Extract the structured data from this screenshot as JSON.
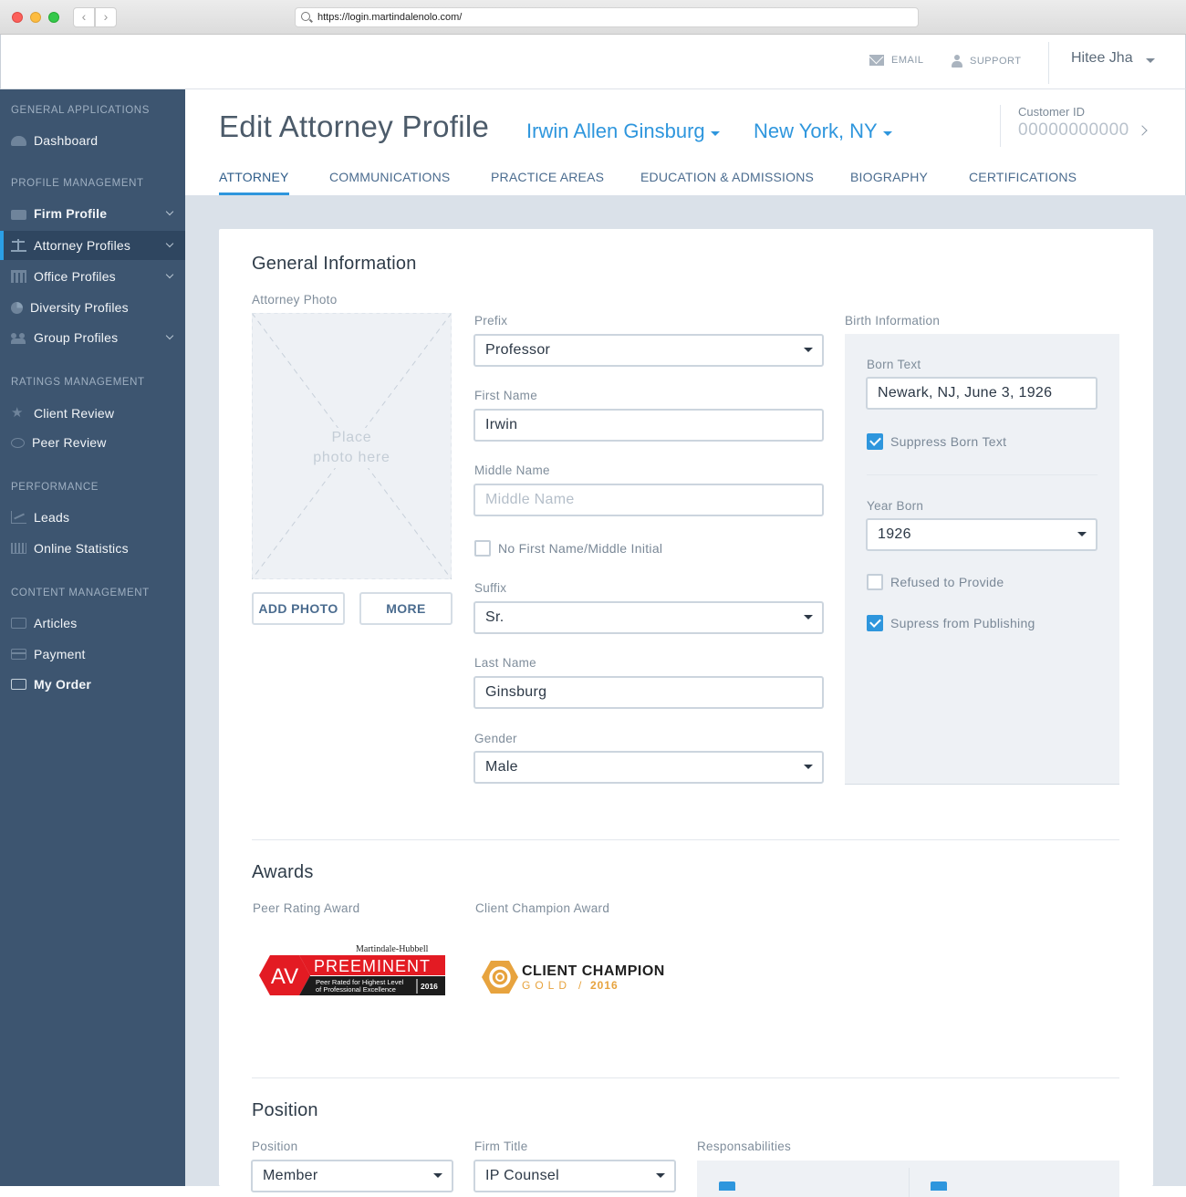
{
  "browser": {
    "url": "https://login.martindalenolo.com/"
  },
  "header": {
    "email_label": "EMAIL",
    "support_label": "SUPPORT",
    "user_name": "Hitee Jha"
  },
  "sidebar": {
    "sections": [
      {
        "title": "GENERAL APPLICATIONS"
      },
      {
        "title": "PROFILE MANAGEMENT"
      },
      {
        "title": "RATINGS MANAGEMENT"
      },
      {
        "title": "PERFORMANCE"
      },
      {
        "title": "CONTENT MANAGEMENT"
      }
    ],
    "items": [
      {
        "label": "Dashboard",
        "icon": "dashboard-icon"
      },
      {
        "label": "Firm Profile",
        "icon": "briefcase-icon"
      },
      {
        "label": "Attorney Profiles",
        "icon": "scale-icon",
        "active": true
      },
      {
        "label": "Office Profiles",
        "icon": "building-icon"
      },
      {
        "label": "Diversity Profiles",
        "icon": "pie-chart-icon"
      },
      {
        "label": "Group Profiles",
        "icon": "group-icon"
      },
      {
        "label": "Client Review",
        "icon": "star-icon"
      },
      {
        "label": "Peer Review",
        "icon": "chat-bubble-icon"
      },
      {
        "label": "Leads",
        "icon": "line-chart-icon"
      },
      {
        "label": "Online Statistics",
        "icon": "bar-chart-icon"
      },
      {
        "label": "Articles",
        "icon": "newspaper-icon"
      },
      {
        "label": "Payment",
        "icon": "credit-card-icon"
      },
      {
        "label": "My Order",
        "icon": "folder-icon"
      }
    ]
  },
  "page": {
    "title": "Edit Attorney Profile",
    "attorney_select": "Irwin Allen Ginsburg",
    "location_select": "New York, NY",
    "customer_id_label": "Customer ID",
    "customer_id": "00000000000"
  },
  "tabs": [
    {
      "label": "ATTORNEY",
      "active": true
    },
    {
      "label": "COMMUNICATIONS"
    },
    {
      "label": "PRACTICE AREAS"
    },
    {
      "label": "EDUCATION & ADMISSIONS"
    },
    {
      "label": "BIOGRAPHY"
    },
    {
      "label": "CERTIFICATIONS"
    }
  ],
  "general": {
    "title": "General Information",
    "photo_label": "Attorney Photo",
    "photo_placeholder_line1": "Place",
    "photo_placeholder_line2": "photo here",
    "add_photo": "ADD PHOTO",
    "more": "MORE",
    "prefix_label": "Prefix",
    "prefix_value": "Professor",
    "first_name_label": "First Name",
    "first_name_value": "Irwin",
    "middle_name_label": "Middle Name",
    "middle_name_placeholder": "Middle Name",
    "no_first_name_label": "No First Name/Middle Initial",
    "no_first_name_checked": false,
    "suffix_label": "Suffix",
    "suffix_value": "Sr.",
    "last_name_label": "Last Name",
    "last_name_value": "Ginsburg",
    "gender_label": "Gender",
    "gender_value": "Male"
  },
  "birth": {
    "title": "Birth Information",
    "born_text_label": "Born Text",
    "born_text_value": "Newark, NJ, June 3, 1926",
    "suppress_born_label": "Suppress Born Text",
    "suppress_born_checked": true,
    "year_born_label": "Year Born",
    "year_born_value": "1926",
    "refused_label": "Refused to Provide",
    "refused_checked": false,
    "supress_publishing_label": "Supress from Publishing",
    "supress_publishing_checked": true
  },
  "awards": {
    "title": "Awards",
    "peer_label": "Peer Rating Award",
    "client_label": "Client Champion Award",
    "av_brand": "Martindale-Hubbell",
    "av_letters": "AV",
    "av_title": "PREEMINENT",
    "av_sub1": "Peer Rated for Highest Level",
    "av_sub2": "of Professional Excellence",
    "av_year": "2016",
    "cc_title": "CLIENT CHAMPION",
    "cc_tier": "GOLD",
    "cc_year": "2016"
  },
  "position": {
    "title": "Position",
    "position_label": "Position",
    "position_value": "Member",
    "firm_title_label": "Firm Title",
    "firm_title_value": "IP Counsel",
    "responsibilities_label": "Responsabilities"
  },
  "colors": {
    "sidebar": "#3d5570",
    "accent": "#2e96dd",
    "award_red": "#e31b23",
    "award_gold": "#e7a33e"
  }
}
